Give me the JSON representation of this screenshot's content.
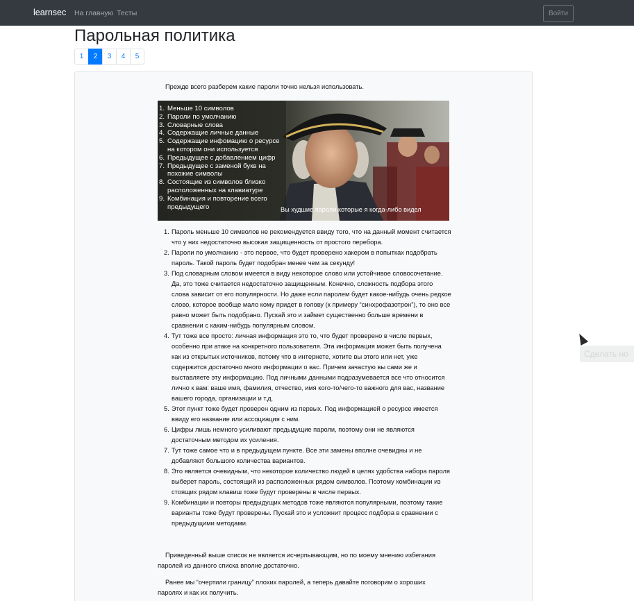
{
  "navbar": {
    "brand": "learnsec",
    "links": [
      "На главную",
      "Тесты"
    ],
    "login_label": "Войти"
  },
  "page": {
    "title": "Парольная политика",
    "pagination": [
      "1",
      "2",
      "3",
      "4",
      "5"
    ],
    "current_page": "2"
  },
  "content": {
    "intro": "Прежде всего разберем какие пароли точно нельзя использовать.",
    "meme": {
      "list": [
        {
          "num": "1.",
          "text": "Меньше 10 символов"
        },
        {
          "num": "2.",
          "text": "Пароли по умолчанию"
        },
        {
          "num": "3.",
          "text": "Словарные слова"
        },
        {
          "num": "4.",
          "text": "Содержащие личные данные"
        },
        {
          "num": "5.",
          "text": "Содержащие инфомацию о ресурсе на котором они используется"
        },
        {
          "num": "6.",
          "text": "Предыдущее с добавлением цифр"
        },
        {
          "num": "7.",
          "text": "Предыдущее с заменой букв на похожие символы"
        },
        {
          "num": "8.",
          "text": "Состоящие из символов близко расположенных на клавиатуре"
        },
        {
          "num": "9.",
          "text": "Комбинация и повторение всего предыдущего"
        }
      ],
      "caption": "Вы худшие пароли которые я когда-либо видел"
    },
    "reasons": [
      {
        "num": "1.",
        "text": "Пароль меньше 10 символов не рекомендуется ввиду того, что на данный момент считается что у них недостаточно высокая защищенность от простого перебора."
      },
      {
        "num": "2.",
        "text": "Пароли по умолчанию - это первое, что будет проверено хакером в попытках подобрать пароль. Такой пароль будет подобран менее чем за секунду!"
      },
      {
        "num": "3.",
        "text": "Под словарным словом имеется в виду некоторое слово или устойчивое словосочетание. Да, это тоже считается недостаточно защищенным. Конечно, сложность подбора этого слова зависит от его популярности. Но даже если паролем будет какое-нибудь очень редкое слово, которое вообще мало кому придет в голову (к примеру “синхрофазотрон”), то оно все равно может быть подобрано. Пускай это и займет существенно больше времени в сравнении с каким-нибудь популярным словом."
      },
      {
        "num": "4.",
        "text": "Тут тоже все просто: личная информация это то, что будет проверено в числе первых, особенно при атаке на конкретного пользователя. Эта информация может быть получена как из открытых источников, потому что в интернете, хотите вы этого или нет, уже содержится достаточно много информации о вас. Причем зачастую вы сами же и выставляете эту информацию. Под личными данными подразумевается все что относится лично к вам: ваше имя, фамилия, отчество, имя кого-то/чего-то важного для вас, название вашего города, организации и т.д."
      },
      {
        "num": "5.",
        "text": "Этот пункт тоже будет проверен одним из первых. Под информацией о ресурсе имеется ввиду его название или ассоциация с ним."
      },
      {
        "num": "6.",
        "text": "Цифры лишь немного усиливают предыдущие пароли, поэтому они не являются достаточным методом их усиления."
      },
      {
        "num": "7.",
        "text": "Тут тоже самое что и в предыдущем пункте. Все эти замены вполне очевидны и не добавляют большого количества вариантов."
      },
      {
        "num": "8.",
        "text": "Это является очевидным, что некоторое количество людей в целях удобства набора пароля выберет пароль, состоящий из расположенных рядом символов. Поэтому комбинации из стоящих рядом клавиш тоже будут проверены в числе первых."
      },
      {
        "num": "9.",
        "text": "Комбинации и повторы предыдущих методов тоже являются популярными, поэтому такие варианты тоже будут проверены. Пускай это и усложнит процесс подбора в сравнении с предыдущими методами."
      }
    ],
    "after_list": "Приведенный выше список не является исчерпывающим, но по моему мнению избегания паролей из данного списка вполне достаточно.",
    "next_paragraph": "Ранее мы “очертили границу” плохих паролей, а теперь давайте поговорим о хороших паролях и как их получить."
  },
  "overlay": {
    "tooltip": "Сделать но"
  }
}
